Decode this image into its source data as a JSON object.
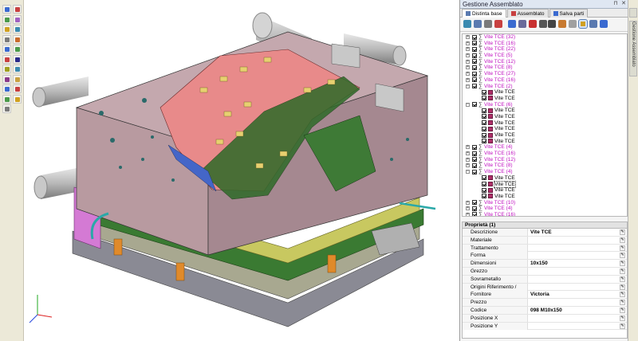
{
  "panel": {
    "title": "Gestione Assemblato",
    "pin_glyph": "⊓",
    "close_glyph": "✕",
    "tabs": [
      {
        "label": "Distinta base",
        "icon": "bom-icon",
        "active": true
      },
      {
        "label": "Assemblato",
        "icon": "assembly-icon",
        "active": false
      },
      {
        "label": "Salva parti",
        "icon": "save-parts-icon",
        "active": false
      }
    ]
  },
  "side_tab": {
    "label": "Gestione Assemblato"
  },
  "tree": {
    "rows": [
      {
        "depth": 0,
        "expander": "+",
        "kind": "group",
        "label": "Vite TCE (32)"
      },
      {
        "depth": 0,
        "expander": "+",
        "kind": "group",
        "label": "Vite TCE (16)"
      },
      {
        "depth": 0,
        "expander": "+",
        "kind": "group",
        "label": "Vite TCE (22)"
      },
      {
        "depth": 0,
        "expander": "+",
        "kind": "group",
        "label": "Vite TCE (5)"
      },
      {
        "depth": 0,
        "expander": "+",
        "kind": "group",
        "label": "Vite TCE (12)"
      },
      {
        "depth": 0,
        "expander": "+",
        "kind": "group",
        "label": "Vite TCE (8)"
      },
      {
        "depth": 0,
        "expander": "+",
        "kind": "group",
        "label": "Vite TCE (27)"
      },
      {
        "depth": 0,
        "expander": "+",
        "kind": "group",
        "label": "Vite TCE (16)"
      },
      {
        "depth": 0,
        "expander": "−",
        "kind": "group",
        "label": "Vite TCE (2)"
      },
      {
        "depth": 1,
        "expander": "",
        "kind": "leaf",
        "label": "Vite TCE"
      },
      {
        "depth": 1,
        "expander": "",
        "kind": "leaf",
        "label": "Vite TCE"
      },
      {
        "depth": 0,
        "expander": "−",
        "kind": "group",
        "label": "Vite TCE (6)"
      },
      {
        "depth": 1,
        "expander": "",
        "kind": "leaf",
        "label": "Vite TCE"
      },
      {
        "depth": 1,
        "expander": "",
        "kind": "leaf",
        "label": "Vite TCE"
      },
      {
        "depth": 1,
        "expander": "",
        "kind": "leaf",
        "label": "Vite TCE"
      },
      {
        "depth": 1,
        "expander": "",
        "kind": "leaf",
        "label": "Vite TCE"
      },
      {
        "depth": 1,
        "expander": "",
        "kind": "leaf",
        "label": "Vite TCE"
      },
      {
        "depth": 1,
        "expander": "",
        "kind": "leaf",
        "label": "Vite TCE"
      },
      {
        "depth": 0,
        "expander": "+",
        "kind": "group",
        "label": "Vite TCE (4)"
      },
      {
        "depth": 0,
        "expander": "+",
        "kind": "group",
        "label": "Vite TCE (16)"
      },
      {
        "depth": 0,
        "expander": "+",
        "kind": "group",
        "label": "Vite TCE (12)"
      },
      {
        "depth": 0,
        "expander": "+",
        "kind": "group",
        "label": "Vite TCE (8)"
      },
      {
        "depth": 0,
        "expander": "−",
        "kind": "group",
        "label": "Vite TCE (4)"
      },
      {
        "depth": 1,
        "expander": "",
        "kind": "leaf",
        "label": "Vite TCE"
      },
      {
        "depth": 1,
        "expander": "",
        "kind": "leaf",
        "label": "Vite TCE",
        "selected": true
      },
      {
        "depth": 1,
        "expander": "",
        "kind": "leaf",
        "label": "Vite TCE"
      },
      {
        "depth": 1,
        "expander": "",
        "kind": "leaf",
        "label": "Vite TCE"
      },
      {
        "depth": 0,
        "expander": "+",
        "kind": "group",
        "label": "Vite TCE (10)"
      },
      {
        "depth": 0,
        "expander": "+",
        "kind": "group",
        "label": "Vite TCE (4)"
      },
      {
        "depth": 0,
        "expander": "+",
        "kind": "group",
        "label": "Vite TCE (16)"
      }
    ]
  },
  "properties": {
    "header": "Proprietà (1)",
    "rows": [
      {
        "key": "Descrizione",
        "value": "Vite TCE"
      },
      {
        "key": "Materiale",
        "value": ""
      },
      {
        "key": "Trattamento",
        "value": ""
      },
      {
        "key": "Forma",
        "value": ""
      },
      {
        "key": "Dimensioni",
        "value": "10x150"
      },
      {
        "key": "Grezzo",
        "value": ""
      },
      {
        "key": "Sovrametallo",
        "value": ""
      },
      {
        "key": "Origini Riferimento / Elettrodo",
        "value": ""
      },
      {
        "key": "Fornitore",
        "value": "Victoria"
      },
      {
        "key": "Prezzo",
        "value": ""
      },
      {
        "key": "Codice",
        "value": "098 M10x150"
      },
      {
        "key": "Posizione X",
        "value": ""
      },
      {
        "key": "Posizione Y",
        "value": ""
      }
    ]
  },
  "colors": {
    "group_text": "#c010c0",
    "plate_mauve": "#b89aa0",
    "cavity_pink": "#e88a8a",
    "plate_green": "#3a7a32",
    "plate_yellow": "#c8c860",
    "accent_selected": "#5880b8"
  }
}
